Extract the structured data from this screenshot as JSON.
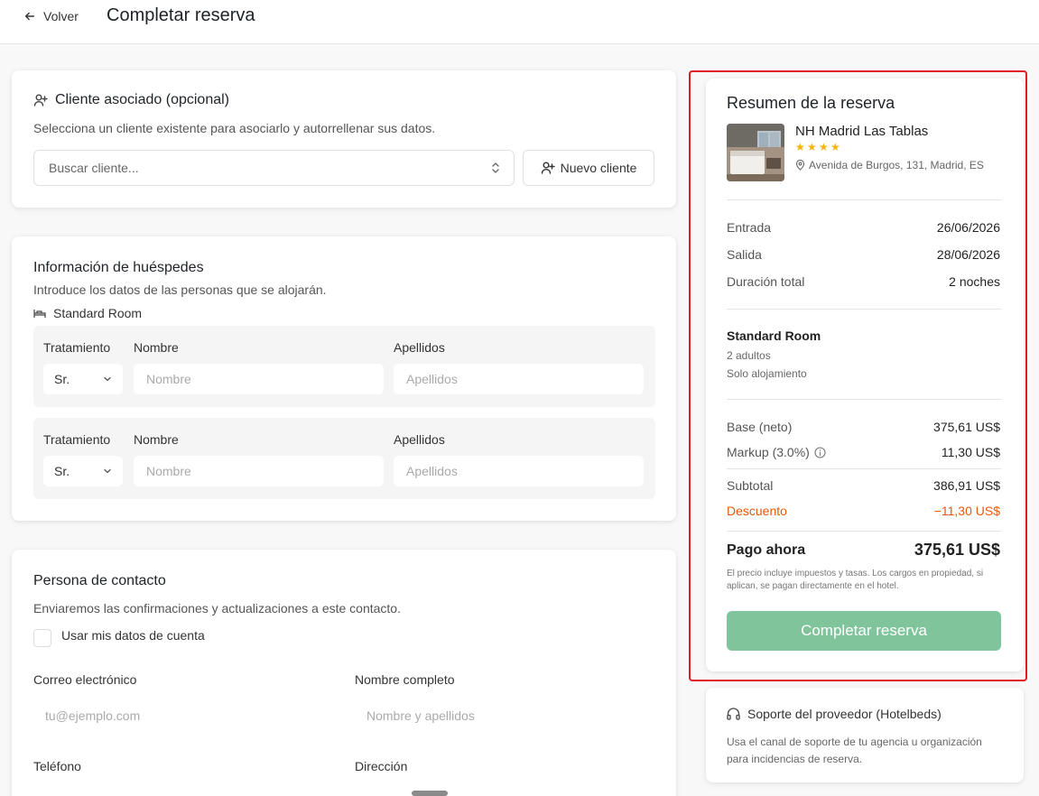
{
  "header": {
    "back_label": "Volver",
    "title": "Completar reserva"
  },
  "client": {
    "title": "Cliente asociado (opcional)",
    "subtitle": "Selecciona un cliente existente para asociarlo y autorrellenar sus datos.",
    "search_placeholder": "Buscar cliente...",
    "new_client_label": "Nuevo cliente"
  },
  "guests": {
    "title": "Información de huéspedes",
    "subtitle": "Introduce los datos de las personas que se alojarán.",
    "room_label": "Standard Room",
    "rows": [
      {
        "treatment_label": "Tratamiento",
        "name_label": "Nombre",
        "surname_label": "Apellidos",
        "treatment_value": "Sr.",
        "name_placeholder": "Nombre",
        "surname_placeholder": "Apellidos"
      },
      {
        "treatment_label": "Tratamiento",
        "name_label": "Nombre",
        "surname_label": "Apellidos",
        "treatment_value": "Sr.",
        "name_placeholder": "Nombre",
        "surname_placeholder": "Apellidos"
      }
    ]
  },
  "contact": {
    "title": "Persona de contacto",
    "subtitle": "Enviaremos las confirmaciones y actualizaciones a este contacto.",
    "use_account_label": "Usar mis datos de cuenta",
    "email_label": "Correo electrónico",
    "email_placeholder": "tu@ejemplo.com",
    "fullname_label": "Nombre completo",
    "fullname_placeholder": "Nombre y apellidos",
    "phone_label": "Teléfono",
    "address_label": "Dirección"
  },
  "summary": {
    "title": "Resumen de la reserva",
    "hotel_name": "NH Madrid Las Tablas",
    "stars": 4,
    "address": "Avenida de Burgos, 131, Madrid, ES",
    "checkin_label": "Entrada",
    "checkin_value": "26/06/2026",
    "checkout_label": "Salida",
    "checkout_value": "28/06/2026",
    "duration_label": "Duración total",
    "duration_value": "2 noches",
    "room_name": "Standard Room",
    "occupancy": "2 adultos",
    "board": "Solo alojamiento",
    "base_label": "Base (neto)",
    "base_value": "375,61 US$",
    "markup_label": "Markup (3.0%)",
    "markup_value": "11,30 US$",
    "subtotal_label": "Subtotal",
    "subtotal_value": "386,91 US$",
    "discount_label": "Descuento",
    "discount_value": "−11,30 US$",
    "pay_now_label": "Pago ahora",
    "pay_now_value": "375,61 US$",
    "disclaimer": "El precio incluye impuestos y tasas. Los cargos en propiedad, si aplican, se pagan directamente en el hotel.",
    "cta_label": "Completar reserva"
  },
  "support": {
    "title": "Soporte del proveedor (Hotelbeds)",
    "text": "Usa el canal de soporte de tu agencia u organización para incidencias de reserva."
  },
  "colors": {
    "accent_green": "#80c49c",
    "discount_orange": "#e8590c",
    "highlight_red": "#e01b24",
    "star_yellow": "#f5b400"
  }
}
